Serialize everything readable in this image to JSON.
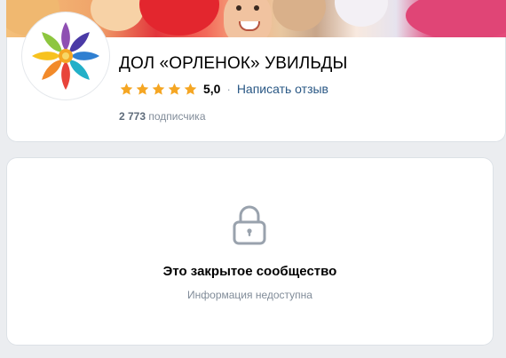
{
  "group": {
    "name": "ДОЛ «ОРЛЕНОК» УВИЛЬДЫ",
    "rating": {
      "value": "5,0",
      "stars": 5,
      "max_stars": 5,
      "separator": "·",
      "review_link": "Написать отзыв",
      "star_color": "#f5a623"
    },
    "subscribers": {
      "count": "2 773",
      "label": "подписчика"
    }
  },
  "closed": {
    "title": "Это закрытое сообщество",
    "subtitle": "Информация недоступна",
    "icon": "lock-icon"
  },
  "colors": {
    "background": "#ebedf0",
    "card": "#ffffff",
    "link": "#2a5885",
    "secondary_text": "#818c99",
    "icon_gray": "#99a2ad"
  }
}
